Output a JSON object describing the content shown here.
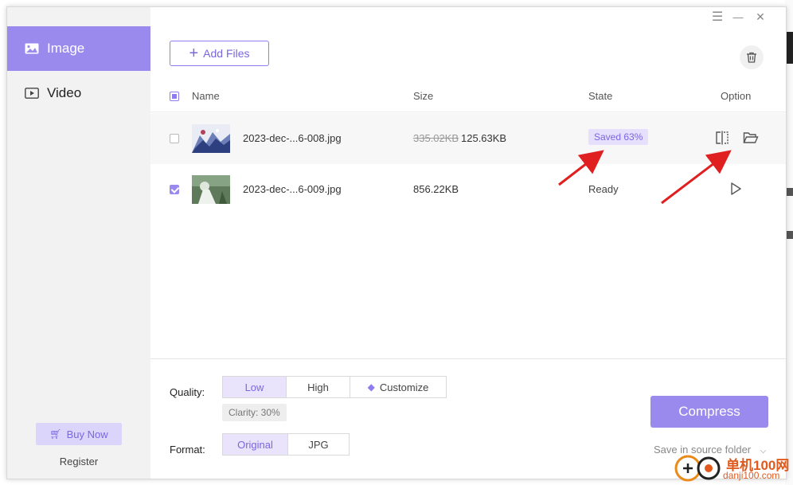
{
  "sidebar": {
    "items": [
      {
        "label": "Image",
        "icon": "image-icon",
        "active": true
      },
      {
        "label": "Video",
        "icon": "video-icon",
        "active": false
      }
    ],
    "buy_label": "Buy Now",
    "register_label": "Register"
  },
  "window_controls": {
    "menu": "☰",
    "minimize": "—",
    "close": "✕"
  },
  "toolbar": {
    "add_label": "Add Files"
  },
  "table": {
    "headers": {
      "name": "Name",
      "size": "Size",
      "state": "State",
      "option": "Option"
    },
    "rows": [
      {
        "filename": "2023-dec-...6-008.jpg",
        "size_original": "335.02KB",
        "size_new": "125.63KB",
        "state": "Saved 63%",
        "checked": false
      },
      {
        "filename": "2023-dec-...6-009.jpg",
        "size_original": "856.22KB",
        "size_new": "",
        "state": "Ready",
        "checked": true
      }
    ]
  },
  "settings": {
    "quality_label": "Quality:",
    "quality_options": [
      "Low",
      "High",
      "Customize"
    ],
    "quality_selected": "Low",
    "clarity": "Clarity: 30%",
    "format_label": "Format:",
    "format_options": [
      "Original",
      "JPG"
    ],
    "format_selected": "Original",
    "compress_label": "Compress",
    "save_location": "Save in source folder"
  },
  "watermark": {
    "text": "单机100网",
    "sub": "danji100.com"
  },
  "colors": {
    "accent": "#9b8aee",
    "accent_text": "#7a66e2",
    "arrow": "#e02020"
  }
}
